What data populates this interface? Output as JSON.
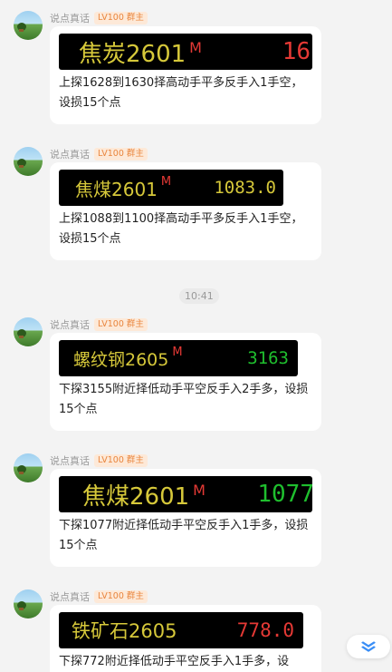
{
  "messages": [
    {
      "sender": "说点真话",
      "badge": "LV100 群主",
      "ticker": {
        "name": "焦炭2601",
        "marker": "M",
        "price": "16",
        "price_color": "#e53935"
      },
      "text": "上探1628到1630择高动手平多反手入1手空，设损15个点"
    },
    {
      "sender": "说点真话",
      "badge": "LV100 群主",
      "ticker": {
        "name": "焦煤2601",
        "marker": "M",
        "price": "1083.0",
        "price_color": "#d6c83a"
      },
      "text": "上探1088到1100择高动手平多反手入1手空，设损15个点"
    },
    {
      "sender": "说点真话",
      "badge": "LV100 群主",
      "ticker": {
        "name": "螺纹钢2605",
        "marker": "M",
        "price": "3163",
        "price_color": "#1fbf2e"
      },
      "text": "下探3155附近择低动手平空反手入2手多，设损15个点"
    },
    {
      "sender": "说点真话",
      "badge": "LV100 群主",
      "ticker": {
        "name": "焦煤2601",
        "marker": "M",
        "price": "1077",
        "price_color": "#1fbf2e"
      },
      "text": "下探1077附近择低动手平空反手入1手多，设损15个点"
    },
    {
      "sender": "说点真话",
      "badge": "LV100 群主",
      "ticker": {
        "name": "铁矿石2605",
        "marker": "",
        "price": "778.0",
        "price_color": "#e53935"
      },
      "text": "下探772附近择低动手平空反手入1手多，设"
    }
  ],
  "time_divider": "10:41",
  "scroll_button": {
    "icon": "double-chevron-down-icon",
    "color": "#3a8ef6"
  }
}
